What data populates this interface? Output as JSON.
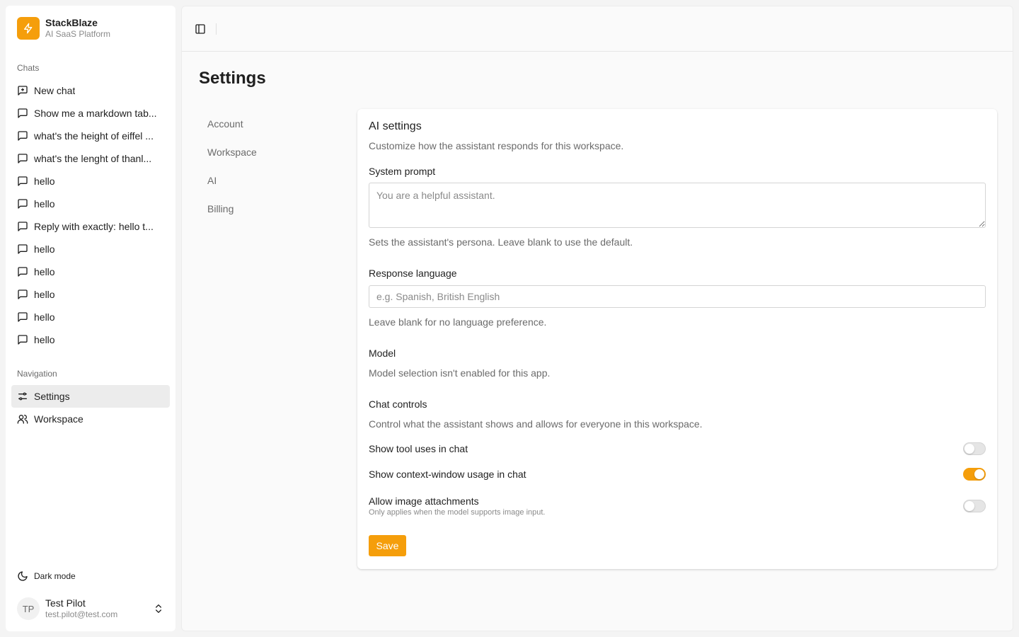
{
  "brand": {
    "name": "StackBlaze",
    "subtitle": "AI SaaS Platform"
  },
  "sidebar": {
    "chats_label": "Chats",
    "chats": [
      {
        "label": "New chat",
        "icon": "square-plus-icon"
      },
      {
        "label": "Show me a markdown tab...",
        "icon": "message-square-icon"
      },
      {
        "label": "what's the height of eiffel ...",
        "icon": "message-square-icon"
      },
      {
        "label": "what's the lenght of thanl...",
        "icon": "message-square-icon"
      },
      {
        "label": "hello",
        "icon": "message-square-icon"
      },
      {
        "label": "hello",
        "icon": "message-square-icon"
      },
      {
        "label": "Reply with exactly: hello t...",
        "icon": "message-square-icon"
      },
      {
        "label": "hello",
        "icon": "message-square-icon"
      },
      {
        "label": "hello",
        "icon": "message-square-icon"
      },
      {
        "label": "hello",
        "icon": "message-square-icon"
      },
      {
        "label": "hello",
        "icon": "message-square-icon"
      },
      {
        "label": "hello",
        "icon": "message-square-icon"
      }
    ],
    "navigation_label": "Navigation",
    "nav": [
      {
        "label": "Settings",
        "icon": "sliders-icon",
        "active": true
      },
      {
        "label": "Workspace",
        "icon": "users-icon",
        "active": false
      }
    ],
    "dark_mode_label": "Dark mode",
    "user": {
      "initials": "TP",
      "name": "Test Pilot",
      "email": "test.pilot@test.com"
    }
  },
  "page": {
    "title": "Settings",
    "settings_nav": [
      "Account",
      "Workspace",
      "AI",
      "Billing"
    ]
  },
  "ai_settings": {
    "title": "AI settings",
    "description": "Customize how the assistant responds for this workspace.",
    "system_prompt": {
      "label": "System prompt",
      "placeholder": "You are a helpful assistant.",
      "help": "Sets the assistant's persona. Leave blank to use the default."
    },
    "response_language": {
      "label": "Response language",
      "placeholder": "e.g. Spanish, British English",
      "help": "Leave blank for no language preference."
    },
    "model": {
      "label": "Model",
      "help": "Model selection isn't enabled for this app."
    },
    "chat_controls": {
      "label": "Chat controls",
      "description": "Control what the assistant shows and allows for everyone in this workspace.",
      "toggles": [
        {
          "label": "Show tool uses in chat",
          "sub": "",
          "on": false
        },
        {
          "label": "Show context-window usage in chat",
          "sub": "",
          "on": true
        },
        {
          "label": "Allow image attachments",
          "sub": "Only applies when the model supports image input.",
          "on": false
        }
      ]
    },
    "save_label": "Save"
  },
  "colors": {
    "accent": "#f59e0b",
    "active_bg": "#ececec"
  }
}
